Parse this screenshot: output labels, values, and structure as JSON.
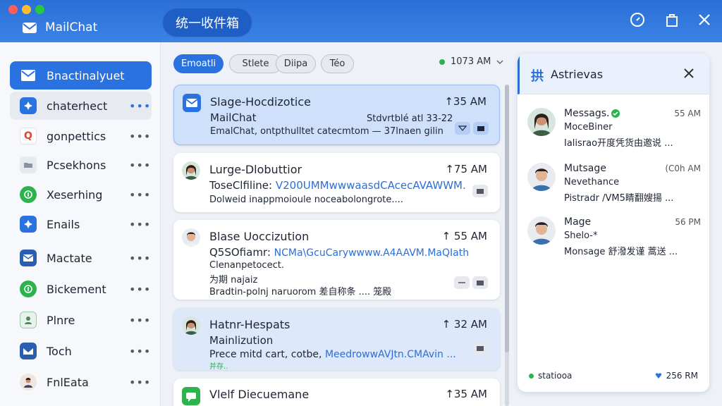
{
  "app": {
    "name": "MailChat",
    "inbox_title": "统一收件箱"
  },
  "sidebar": {
    "items": [
      {
        "label": "Bnactinalyuet",
        "icon": "mail-icon"
      },
      {
        "label": "chaterhect",
        "icon": "chat-bubble-icon"
      },
      {
        "label": "gonpettics",
        "icon": "q-logo-icon"
      },
      {
        "label": "Pcsekhons",
        "icon": "folder-icon"
      },
      {
        "label": "Xeserhing",
        "icon": "info-circle-icon"
      },
      {
        "label": "Enails",
        "icon": "badge-icon"
      },
      {
        "label": "Mactate",
        "icon": "mail-icon"
      },
      {
        "label": "Bickement",
        "icon": "info-circle-icon"
      },
      {
        "label": "Plnre",
        "icon": "person-icon"
      },
      {
        "label": "Toch",
        "icon": "inbox-tray-icon"
      },
      {
        "label": "FnlEata",
        "icon": "avatar-icon"
      }
    ],
    "more_glyph": "•••"
  },
  "filters": {
    "items": [
      "Emoatli",
      "Stlete",
      "Diipa",
      "Téo"
    ],
    "time_label": "1073 AM"
  },
  "messages": [
    {
      "title": "Slage-Hocdizotice",
      "time": "↑35 AM",
      "line2": "MailChat",
      "line2b": "Stdvrtblé atl 33-22",
      "line3": "EmalChat, ontpthulltet catecmtom — 37lnaen gilin"
    },
    {
      "title": "Lurge-Dlobuttior",
      "time": "↑75 AM",
      "line2": "ToseClfiline:",
      "line2_link": "V200UMMwwwaasdCAcecAVAWWM.",
      "line3": "Dolweid inappmoioule noceabolongrote...."
    },
    {
      "title": "Blase Uoccizution",
      "time": "↑ 55 AM",
      "line2": "Q5SOfiamr:",
      "line2_link": "NCMa\\GcuCarywwww.A4AAVM.MaQIath",
      "line3": "Clenanpetocect.",
      "line4": "为期 najaiz",
      "line5": "Bradtin-polnj naruorom 差自称条 .... 笼殿"
    },
    {
      "title": "Hatnr-Hespats",
      "time": "↑ 32 AM",
      "line2": "Mainlizution",
      "line3": "Prece mitd cart, cotbe,",
      "line3_link": "MeedrowwAVJtn.CMAvin ...",
      "line4": "并存.."
    },
    {
      "title": "Vlelf Diecuemane",
      "time": "↑35 AM"
    }
  ],
  "right_panel": {
    "title": "Astrievas",
    "logo": "拱",
    "rows": [
      {
        "name": "Messags.",
        "time": "55 AM",
        "line2": "MoceBiner",
        "line3": "Ialisrao开度凭货由邀说 ..."
      },
      {
        "name": "Mutsage",
        "time": "(C0h AM",
        "line2": "Nevethance",
        "line3": "Pistradr /VM5睛翻嫂揚 ..."
      },
      {
        "name": "Mage",
        "time": "56 PM",
        "line2": "Shelo-*",
        "line3": "Monsage 舒潑发谨    蒿送 ..."
      }
    ],
    "footer_left": "statiooa",
    "footer_right": "256 RM"
  },
  "colors": {
    "accent": "#2a6fd6",
    "titlebar": "#3b82e6",
    "selected_card": "#cfe0fb"
  }
}
